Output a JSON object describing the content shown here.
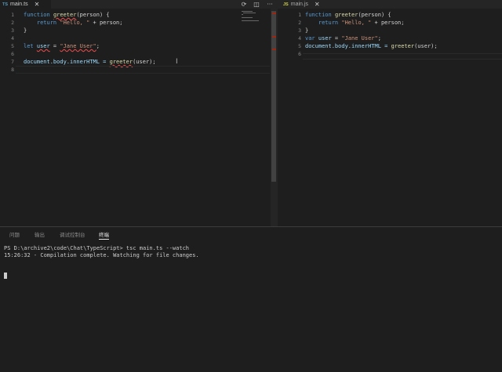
{
  "tabs": {
    "left": {
      "badge": "TS",
      "label": "main.ts",
      "close": "✕"
    },
    "right": {
      "badge": "JS",
      "label": "main.js",
      "close": "✕"
    }
  },
  "toolbar": {
    "open_changes_icon": "⟳",
    "split_editor_icon": "◫",
    "more_actions": "···"
  },
  "editor_left": {
    "line_numbers": [
      "1",
      "2",
      "3",
      "4",
      "5",
      "6",
      "7",
      "8"
    ],
    "lines": [
      {
        "tokens": [
          {
            "t": "function ",
            "c": "kw"
          },
          {
            "t": "greeter",
            "c": "fn squig"
          },
          {
            "t": "(person) {",
            "c": ""
          }
        ]
      },
      {
        "tokens": [
          {
            "t": "    ",
            "c": ""
          },
          {
            "t": "return ",
            "c": "kw"
          },
          {
            "t": "\"Hello, \"",
            "c": "str"
          },
          {
            "t": " + person;",
            "c": ""
          }
        ]
      },
      {
        "tokens": [
          {
            "t": "}",
            "c": ""
          }
        ]
      },
      {
        "tokens": []
      },
      {
        "tokens": [
          {
            "t": "let ",
            "c": "kw"
          },
          {
            "t": "user",
            "c": "var squig"
          },
          {
            "t": " = ",
            "c": ""
          },
          {
            "t": "\"Jane User\"",
            "c": "str squig"
          },
          {
            "t": ";",
            "c": ""
          }
        ]
      },
      {
        "tokens": []
      },
      {
        "tokens": [
          {
            "t": "document.body.innerHTML = ",
            "c": "var"
          },
          {
            "t": "greeter",
            "c": "fn squig"
          },
          {
            "t": "(user);",
            "c": ""
          }
        ]
      },
      {
        "tokens": []
      }
    ]
  },
  "editor_right": {
    "line_numbers": [
      "1",
      "2",
      "3",
      "4",
      "5",
      "6"
    ],
    "lines": [
      {
        "tokens": [
          {
            "t": "function ",
            "c": "kw"
          },
          {
            "t": "greeter",
            "c": "fn"
          },
          {
            "t": "(person) {",
            "c": ""
          }
        ]
      },
      {
        "tokens": [
          {
            "t": "    ",
            "c": ""
          },
          {
            "t": "return ",
            "c": "kw"
          },
          {
            "t": "\"Hello, \"",
            "c": "str"
          },
          {
            "t": " + person;",
            "c": ""
          }
        ]
      },
      {
        "tokens": [
          {
            "t": "}",
            "c": ""
          }
        ]
      },
      {
        "tokens": [
          {
            "t": "var ",
            "c": "kw"
          },
          {
            "t": "user",
            "c": "var"
          },
          {
            "t": " = ",
            "c": ""
          },
          {
            "t": "\"Jane User\"",
            "c": "str"
          },
          {
            "t": ";",
            "c": ""
          }
        ]
      },
      {
        "tokens": [
          {
            "t": "document.body.innerHTML = ",
            "c": "var"
          },
          {
            "t": "greeter",
            "c": "fn"
          },
          {
            "t": "(user);",
            "c": ""
          }
        ]
      },
      {
        "tokens": []
      }
    ]
  },
  "panel": {
    "tabs": [
      "问题",
      "输出",
      "调试控制台",
      "终端"
    ],
    "active_tab": "终端",
    "terminal_lines": [
      "PS D:\\archive2\\code\\Chat\\TypeScript> tsc main.ts --watch",
      "15:26:32 - Compilation complete. Watching for file changes."
    ]
  },
  "colors": {
    "background": "#1e1e1e",
    "keyword": "#569cd6",
    "string": "#ce9178",
    "function": "#dcdcaa",
    "error": "#f14c4c"
  }
}
